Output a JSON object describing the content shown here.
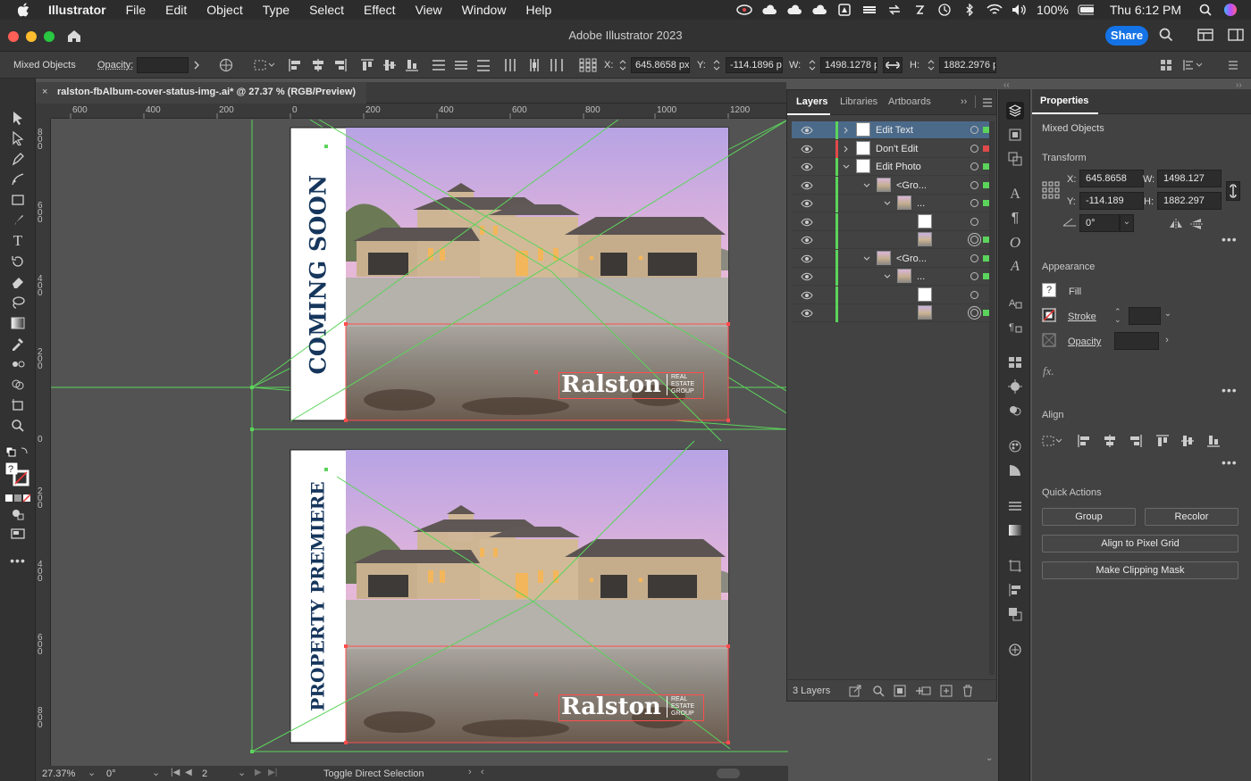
{
  "menubar": {
    "app_name": "Illustrator",
    "items": [
      "File",
      "Edit",
      "Object",
      "Type",
      "Select",
      "Effect",
      "View",
      "Window",
      "Help"
    ],
    "battery": "100%",
    "datetime": "Thu 6:12 PM"
  },
  "window": {
    "title": "Adobe Illustrator 2023",
    "share_label": "Share"
  },
  "controlbar": {
    "selection": "Mixed Objects",
    "opacity_label": "Opacity:",
    "x_label": "X:",
    "x_value": "645.8658 px",
    "y_label": "Y:",
    "y_value": "-114.1896 px",
    "w_label": "W:",
    "w_value": "1498.1278 px",
    "h_label": "H:",
    "h_value": "1882.2976 px"
  },
  "document_tab": {
    "title": "ralston-fbAlbum-cover-status-img-.ai* @ 27.37 % (RGB/Preview)"
  },
  "rulers": {
    "horizontal": [
      "600",
      "400",
      "200",
      "0",
      "200",
      "400",
      "600",
      "800",
      "1000",
      "1200"
    ],
    "vertical": [
      "800",
      "600",
      "400",
      "200",
      "0",
      "200",
      "400",
      "600",
      "800"
    ]
  },
  "artwork": {
    "top": {
      "headline": "COMING SOON"
    },
    "bottom": {
      "headline": "PROPERTY PREMIERE"
    },
    "logo_text": "Ralston",
    "logo_sub": [
      "REAL",
      "ESTATE",
      "GROUP"
    ]
  },
  "statusbar": {
    "zoom": "27.37%",
    "rotation": "0°",
    "artboard": "2",
    "tool_hint": "Toggle Direct Selection"
  },
  "layers_panel": {
    "tabs": [
      "Layers",
      "Libraries",
      "Artboards"
    ],
    "rows": [
      {
        "name": "Edit Text",
        "level": 0,
        "expanded": false,
        "color": "#5bd45b",
        "selected": true,
        "square": "#5bd45b"
      },
      {
        "name": "Don't Edit",
        "level": 0,
        "expanded": false,
        "color": "#e04a4a",
        "selected": false,
        "square": "#e04a4a"
      },
      {
        "name": "Edit Photo",
        "level": 0,
        "expanded": true,
        "color": "#5bd45b",
        "selected": false,
        "square": "#5bd45b"
      },
      {
        "name": "<Gro...",
        "level": 1,
        "expanded": true,
        "color": "#5bd45b",
        "selected": false,
        "square": "#5bd45b"
      },
      {
        "name": "...",
        "level": 2,
        "expanded": true,
        "color": "#5bd45b",
        "selected": false,
        "square": "#5bd45b"
      },
      {
        "name": "",
        "level": 3,
        "expanded": false,
        "color": "#5bd45b",
        "selected": false,
        "square": ""
      },
      {
        "name": "",
        "level": 3,
        "expanded": false,
        "color": "#5bd45b",
        "selected": false,
        "square": "#5bd45b"
      },
      {
        "name": "<Gro...",
        "level": 1,
        "expanded": true,
        "color": "#5bd45b",
        "selected": false,
        "square": "#5bd45b"
      },
      {
        "name": "...",
        "level": 2,
        "expanded": true,
        "color": "#5bd45b",
        "selected": false,
        "square": "#5bd45b"
      },
      {
        "name": "",
        "level": 3,
        "expanded": false,
        "color": "#5bd45b",
        "selected": false,
        "square": ""
      },
      {
        "name": "",
        "level": 3,
        "expanded": false,
        "color": "#5bd45b",
        "selected": false,
        "square": "#5bd45b"
      }
    ],
    "footer": "3 Layers"
  },
  "properties": {
    "tab": "Properties",
    "selection": "Mixed Objects",
    "transform_title": "Transform",
    "x_label": "X:",
    "x": "645.8658",
    "y_label": "Y:",
    "y": "-114.189",
    "w_label": "W:",
    "w": "1498.127",
    "h_label": "H:",
    "h": "1882.297",
    "angle": "0°",
    "appearance_title": "Appearance",
    "fill_label": "Fill",
    "stroke_label": "Stroke",
    "opacity_label": "Opacity",
    "fx_label": "fx.",
    "align_title": "Align",
    "quick_actions_title": "Quick Actions",
    "group_btn": "Group",
    "recolor_btn": "Recolor",
    "align_pixel_btn": "Align to Pixel Grid",
    "clipping_btn": "Make Clipping Mask"
  },
  "colors": {
    "accent": "#1473e6",
    "guide_green": "#5bd45b",
    "selection_red": "#ff4d4d",
    "navy_text": "#16365c"
  }
}
